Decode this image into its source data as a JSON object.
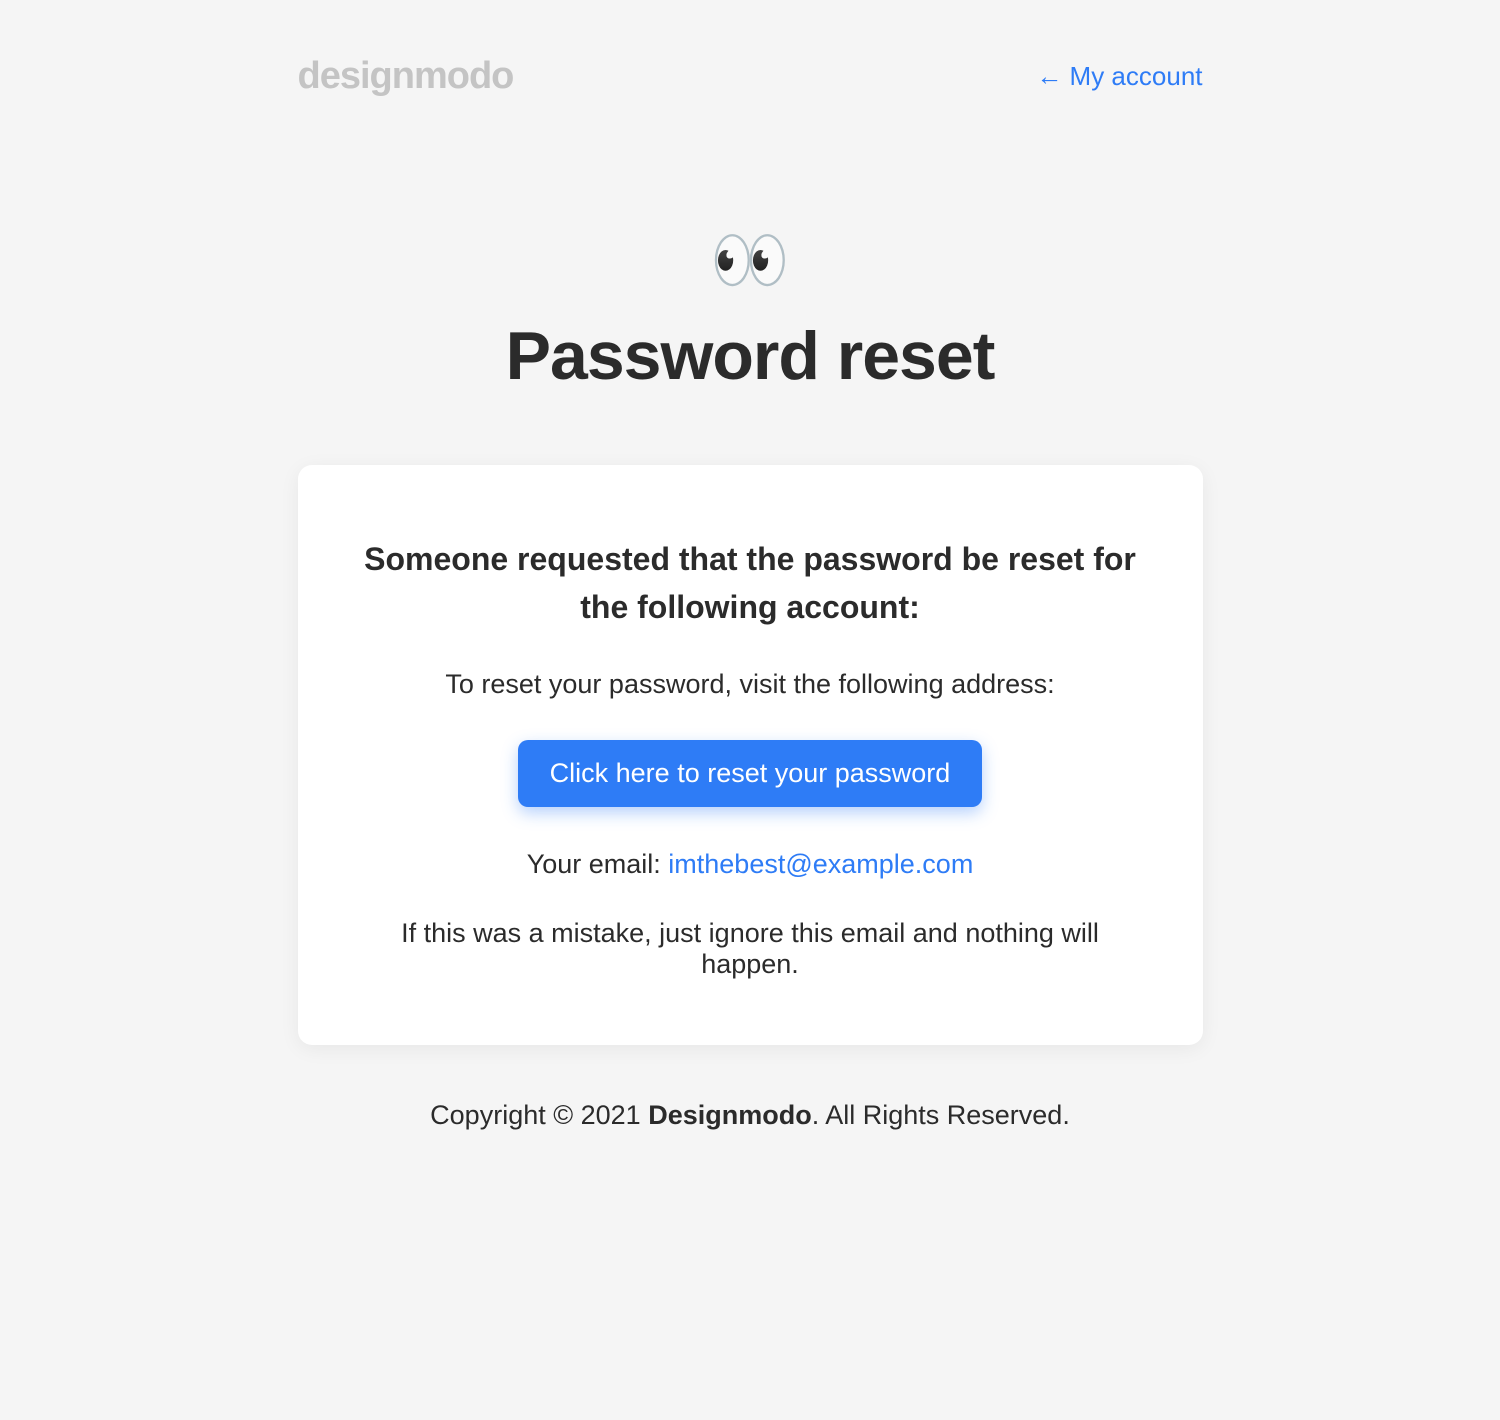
{
  "header": {
    "logo_text": "designmodo",
    "account_link": "← My account"
  },
  "hero": {
    "emoji": "👀",
    "title": "Password reset"
  },
  "card": {
    "heading": "Someone requested that the password be reset for the following account:",
    "instruction": "To reset your password, visit the following address:",
    "button_label": "Click here to reset your password",
    "email_label": "Your email: ",
    "email_value": "imthebest@example.com",
    "disclaimer": "If this was a mistake, just ignore this email and nothing will happen."
  },
  "footer": {
    "copyright_prefix": "Copyright © 2021 ",
    "brand": "Designmodo",
    "copyright_suffix": ". All Rights Reserved."
  }
}
